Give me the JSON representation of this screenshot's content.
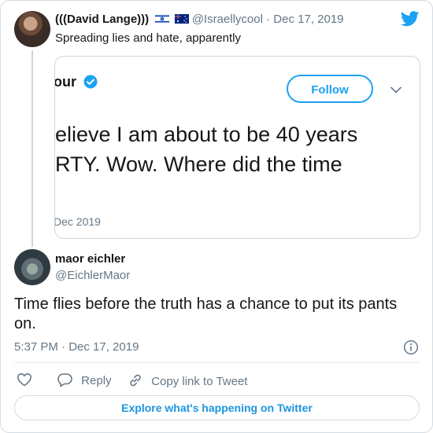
{
  "parent_tweet": {
    "display_name": "(((David Lange)))",
    "handle": "@Israellycool",
    "date": "· Dec 17, 2019",
    "text": "Spreading lies and hate, apparently",
    "flags": [
      "israel-flag",
      "australia-flag"
    ]
  },
  "quoted_tweet": {
    "name_fragment": "our",
    "follow_label": "Follow",
    "text_line1": "elieve I am about to be 40 years",
    "text_line2": "RTY. Wow. Where did the time",
    "date_fragment": "Dec 2019"
  },
  "reply_tweet": {
    "display_name": "maor eichler",
    "handle": "@EichlerMaor",
    "text": "Time flies before the truth has a chance to put its pants on.",
    "timestamp": "5:37 PM · Dec 17, 2019"
  },
  "actions": {
    "reply_label": "Reply",
    "copy_link_label": "Copy link to Tweet"
  },
  "explore_label": "Explore what's happening on Twitter",
  "colors": {
    "accent": "#1da1f2",
    "muted": "#657786",
    "text": "#14171a",
    "border": "#ccd6dd"
  }
}
